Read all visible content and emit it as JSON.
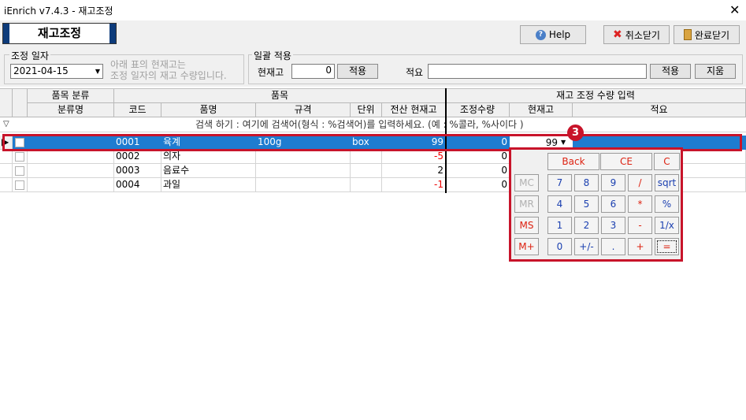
{
  "window": {
    "title": "iEnrich v7.4.3 - 재고조정",
    "close_glyph": "✕"
  },
  "header": {
    "label": "재고조정"
  },
  "toolbar": {
    "help": "Help",
    "cancel_close": "취소닫기",
    "done_close": "완료닫기"
  },
  "adjust_date": {
    "legend": "조정 일자",
    "value": "2021-04-15",
    "note_line1": "아래 표의 현재고는",
    "note_line2": "조정 일자의 재고 수량입니다."
  },
  "bulk_apply": {
    "legend": "일괄 적용",
    "current_stock_label": "현재고",
    "current_stock_value": "0",
    "apply_label": "적용",
    "memo_label": "적요",
    "memo_value": "",
    "apply_label2": "적용",
    "clear_label": "지움"
  },
  "grid": {
    "group_headers": {
      "category": "품목 분류",
      "item": "품목",
      "adjust_input": "재고 조정 수량 입력"
    },
    "columns": {
      "category_name": "분류명",
      "code": "코드",
      "name": "품명",
      "spec": "규격",
      "unit": "단위",
      "system_stock": "전산 현재고",
      "adjust_qty": "조정수량",
      "current_stock": "현재고",
      "memo": "적요"
    },
    "filter_hint": "검색 하기 : 여기에 검색어(형식 : %검색어)를 입력하세요. (예 : %콜라, %사이다 )",
    "rows": [
      {
        "category": "",
        "code": "0001",
        "name": "육계",
        "spec": "100g",
        "unit": "box",
        "system_stock": "99",
        "adjust_qty": "0",
        "current_stock": "99"
      },
      {
        "category": "",
        "code": "0002",
        "name": "의자",
        "spec": "",
        "unit": "",
        "system_stock": "-5",
        "adjust_qty": "0",
        "current_stock": ""
      },
      {
        "category": "",
        "code": "0003",
        "name": "음료수",
        "spec": "",
        "unit": "",
        "system_stock": "2",
        "adjust_qty": "0",
        "current_stock": ""
      },
      {
        "category": "",
        "code": "0004",
        "name": "과일",
        "spec": "",
        "unit": "",
        "system_stock": "-1",
        "adjust_qty": "0",
        "current_stock": ""
      }
    ]
  },
  "badge": {
    "number": "3"
  },
  "calculator": {
    "back": "Back",
    "ce": "CE",
    "c": "C",
    "mc": "MC",
    "mr": "MR",
    "ms": "MS",
    "mplus": "M+",
    "k7": "7",
    "k8": "8",
    "k9": "9",
    "div": "/",
    "sqrt": "sqrt",
    "k4": "4",
    "k5": "5",
    "k6": "6",
    "mul": "*",
    "pct": "%",
    "k1": "1",
    "k2": "2",
    "k3": "3",
    "sub": "-",
    "recip": "1/x",
    "k0": "0",
    "neg": "+/-",
    "dot": ".",
    "add": "+",
    "eq": "="
  }
}
